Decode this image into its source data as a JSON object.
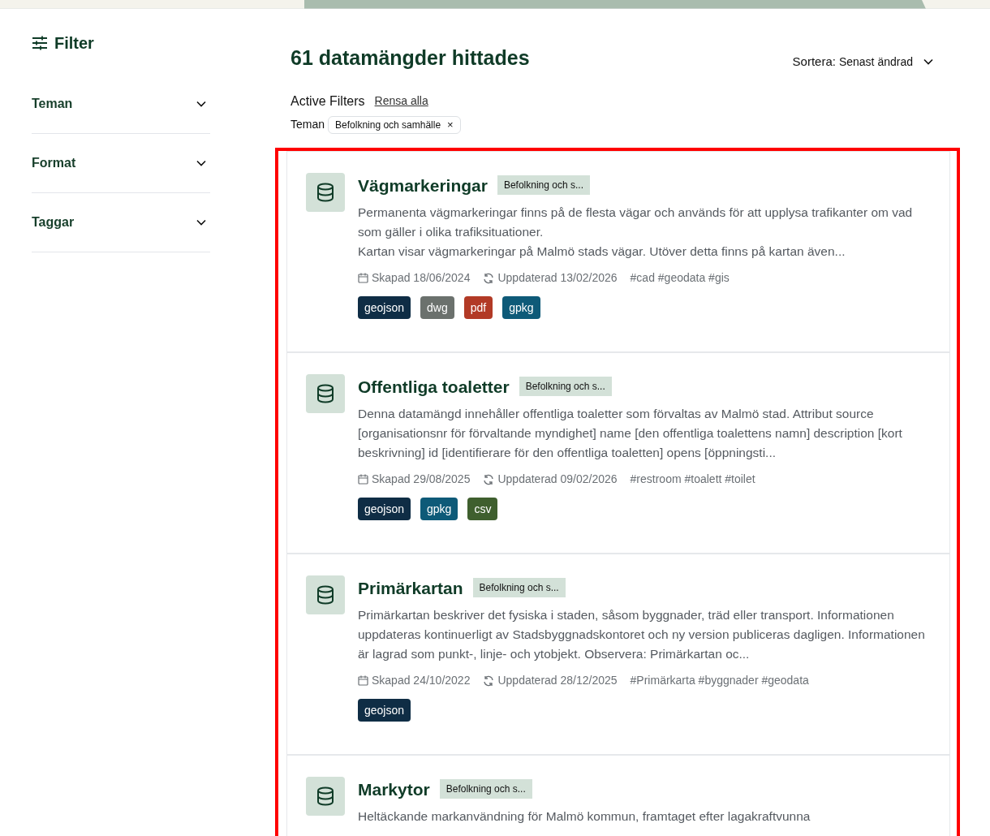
{
  "sidebar": {
    "title": "Filter",
    "groups": [
      {
        "label": "Teman",
        "expanded": false
      },
      {
        "label": "Format",
        "expanded": false
      },
      {
        "label": "Taggar",
        "expanded": false
      }
    ]
  },
  "results": {
    "heading": "61 datamängder hittades",
    "sort": {
      "label": "Sortera:",
      "value": "Senast ändrad"
    }
  },
  "active_filters": {
    "label": "Active Filters",
    "clear": "Rensa alla",
    "filters": [
      {
        "group": "Teman",
        "value": "Befolkning och samhälle",
        "remove": "×"
      }
    ]
  },
  "datasets": [
    {
      "title": "Vägmarkeringar",
      "theme": "Befolkning och s...",
      "description": [
        "Permanenta vägmarkeringar finns på de flesta vägar och används för att upplysa trafikanter om vad som gäller i olika trafiksituationer.",
        "Kartan visar vägmarkeringar på Malmö stads vägar. Utöver detta finns på kartan även..."
      ],
      "created": "Skapad 18/06/2024",
      "updated": "Uppdaterad 13/02/2026",
      "tags": "#cad #geodata #gis",
      "formats": [
        {
          "label": "geojson",
          "color": "#0f2d45"
        },
        {
          "label": "dwg",
          "color": "#6b716d"
        },
        {
          "label": "pdf",
          "color": "#b23a26"
        },
        {
          "label": "gpkg",
          "color": "#0e5a78"
        }
      ]
    },
    {
      "title": "Offentliga toaletter",
      "theme": "Befolkning och s...",
      "description": [
        "Denna datamängd innehåller offentliga toaletter som förvaltas av Malmö stad. Attribut source [organisationsnr för förvaltande myndighet] name [den offentliga toalettens namn] description [kort beskrivning] id [identifierare för den offentliga toaletten] opens [öppningsti..."
      ],
      "created": "Skapad 29/08/2025",
      "updated": "Uppdaterad 09/02/2026",
      "tags": "#restroom #toalett #toilet",
      "formats": [
        {
          "label": "geojson",
          "color": "#0f2d45"
        },
        {
          "label": "gpkg",
          "color": "#0e5a78"
        },
        {
          "label": "csv",
          "color": "#3f5f2e"
        }
      ]
    },
    {
      "title": "Primärkartan",
      "theme": "Befolkning och s...",
      "description": [
        "Primärkartan beskriver det fysiska i staden, såsom byggnader, träd eller transport. Informationen uppdateras kontinuerligt av Stadsbyggnadskontoret och ny version publiceras dagligen. Informationen är lagrad som punkt-, linje- och ytobjekt. Observera: Primärkartan oc..."
      ],
      "created": "Skapad 24/10/2022",
      "updated": "Uppdaterad 28/12/2025",
      "tags": "#Primärkarta #byggnader #geodata",
      "formats": [
        {
          "label": "geojson",
          "color": "#0f2d45"
        }
      ]
    },
    {
      "title": "Markytor",
      "theme": "Befolkning och s...",
      "description": [
        "Heltäckande markanvändning för Malmö kommun, framtaget efter lagakraftvunna"
      ]
    }
  ]
}
